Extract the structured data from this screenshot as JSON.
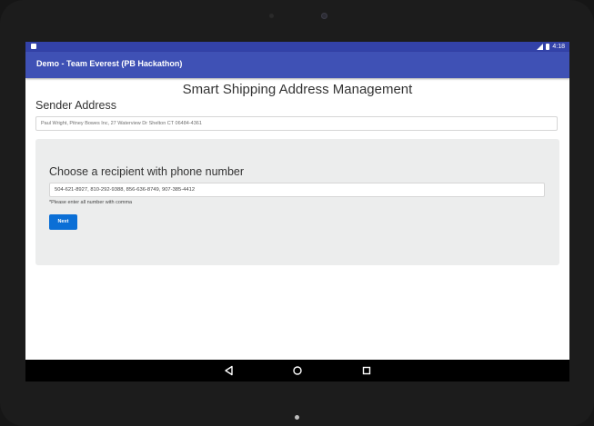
{
  "status_bar": {
    "time": "4:18",
    "notification_icon": "square-notification-icon",
    "signal_icon": "signal-icon",
    "battery_icon": "battery-icon"
  },
  "app_bar": {
    "title": "Demo - Team Everest (PB Hackathon)"
  },
  "page": {
    "title": "Smart Shipping Address Management"
  },
  "sender": {
    "label": "Sender Address",
    "value": "Paul Wright, Pitney Bowes Inc, 27 Waterview Dr Shelton CT 06484-4361"
  },
  "recipient": {
    "label": "Choose a recipient with phone number",
    "phone_value": "504-621-8927, 810-292-9388, 856-636-8749, 907-385-4412",
    "hint": "*Please enter all number with comma",
    "next_label": "Next"
  },
  "nav_bar": {
    "back_icon": "back-triangle-icon",
    "home_icon": "home-circle-icon",
    "recents_icon": "recents-square-icon"
  },
  "colors": {
    "status_bar": "#3342a8",
    "app_bar": "#3f51b5",
    "panel": "#eceded",
    "button": "#0b6fd6"
  }
}
